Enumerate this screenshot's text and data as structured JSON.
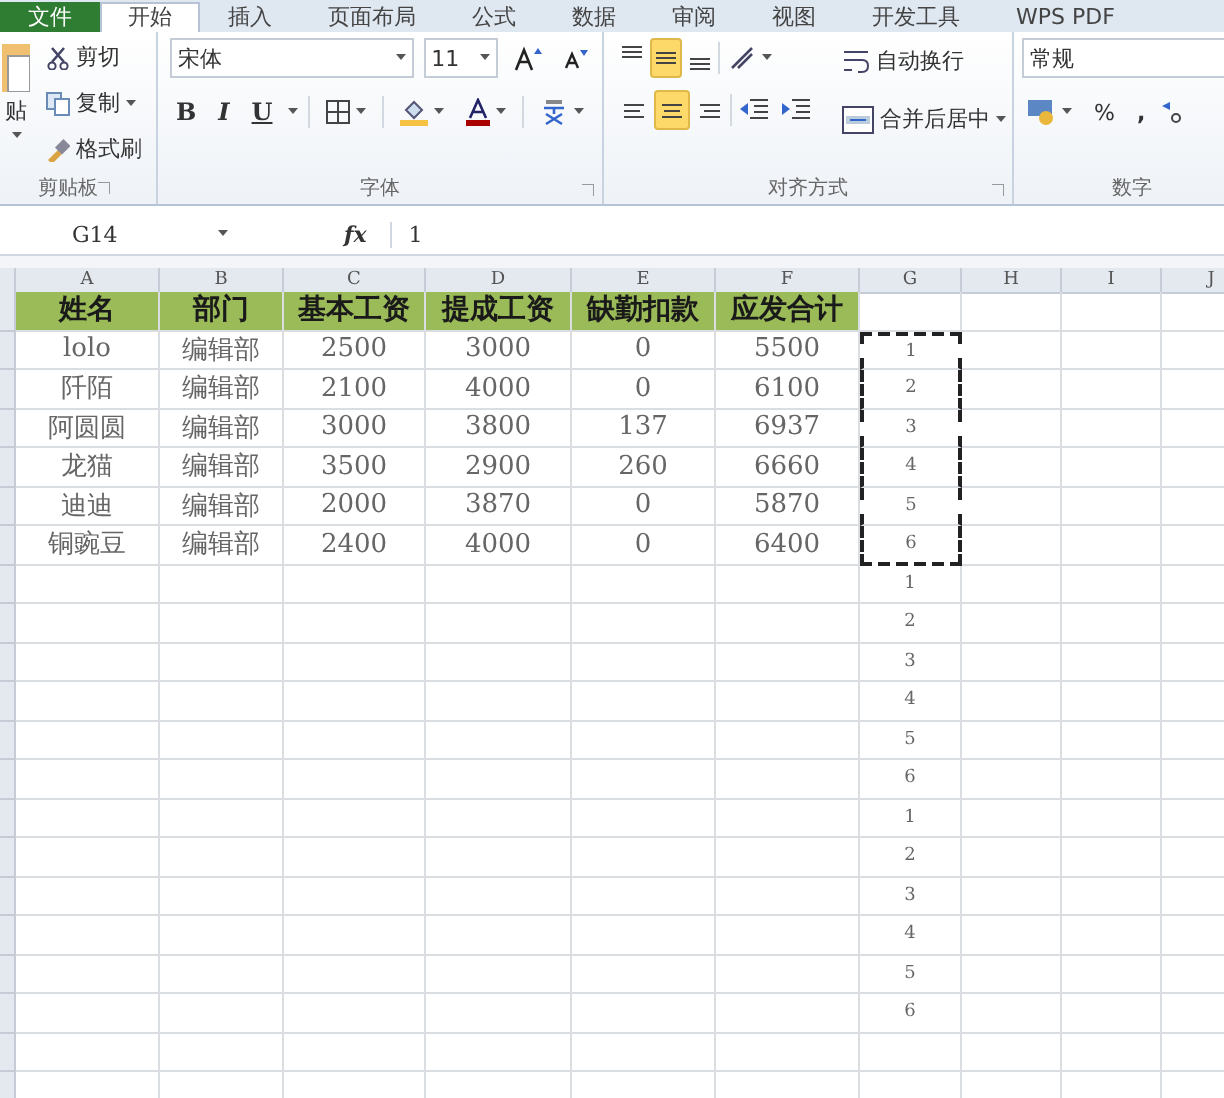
{
  "ribbon_tabs": [
    {
      "label": "文件",
      "kind": "file",
      "selected": false
    },
    {
      "label": "开始",
      "kind": "tab",
      "selected": true
    },
    {
      "label": "插入",
      "kind": "tab",
      "selected": false
    },
    {
      "label": "页面布局",
      "kind": "tab",
      "selected": false
    },
    {
      "label": "公式",
      "kind": "tab",
      "selected": false
    },
    {
      "label": "数据",
      "kind": "tab",
      "selected": false
    },
    {
      "label": "审阅",
      "kind": "tab",
      "selected": false
    },
    {
      "label": "视图",
      "kind": "tab",
      "selected": false
    },
    {
      "label": "开发工具",
      "kind": "tab",
      "selected": false
    },
    {
      "label": "WPS PDF",
      "kind": "tab",
      "selected": false
    }
  ],
  "clipboard": {
    "paste": "贴",
    "cut": "剪切",
    "copy": "复制",
    "format_painter": "格式刷",
    "group_label": "剪贴板"
  },
  "font": {
    "name": "宋体",
    "size": "11",
    "bold": "B",
    "italic": "I",
    "underline": "U",
    "group_label": "字体"
  },
  "alignment": {
    "vertical": [
      {
        "selected": false
      },
      {
        "selected": true
      },
      {
        "selected": false
      }
    ],
    "horizontal": [
      {
        "selected": false
      },
      {
        "selected": true
      },
      {
        "selected": false
      }
    ],
    "wrap": "自动换行",
    "merge": "合并后居中",
    "group_label": "对齐方式"
  },
  "number": {
    "format": "常规",
    "percent": "%",
    "comma": ",",
    "group_label": "数字"
  },
  "formula_bar": {
    "name_box": "G14",
    "fx": "fx",
    "value": "1"
  },
  "sheet": {
    "columns": [
      "A",
      "B",
      "C",
      "D",
      "E",
      "F",
      "G",
      "H",
      "I",
      "J"
    ],
    "header_row": [
      "姓名",
      "部门",
      "基本工资",
      "提成工资",
      "缺勤扣款",
      "应发合计"
    ],
    "rows": [
      {
        "cells": [
          "lolo",
          "编辑部",
          "2500",
          "3000",
          "0",
          "5500"
        ],
        "g": "1",
        "in_copy_range": true
      },
      {
        "cells": [
          "阡陌",
          "编辑部",
          "2100",
          "4000",
          "0",
          "6100"
        ],
        "g": "2",
        "in_copy_range": true
      },
      {
        "cells": [
          "阿圆圆",
          "编辑部",
          "3000",
          "3800",
          "137",
          "6937"
        ],
        "g": "3",
        "in_copy_range": true
      },
      {
        "cells": [
          "龙猫",
          "编辑部",
          "3500",
          "2900",
          "260",
          "6660"
        ],
        "g": "4",
        "in_copy_range": true
      },
      {
        "cells": [
          "迪迪",
          "编辑部",
          "2000",
          "3870",
          "0",
          "5870"
        ],
        "g": "5",
        "in_copy_range": true
      },
      {
        "cells": [
          "铜豌豆",
          "编辑部",
          "2400",
          "4000",
          "0",
          "6400"
        ],
        "g": "6",
        "in_copy_range": true
      },
      {
        "g": "1",
        "in_copy_range": false
      },
      {
        "g": "2",
        "in_copy_range": false
      },
      {
        "g": "3",
        "in_copy_range": false
      },
      {
        "g": "4",
        "in_copy_range": false
      },
      {
        "g": "5",
        "in_copy_range": false
      },
      {
        "g": "6",
        "in_copy_range": false
      },
      {
        "g": "1",
        "in_copy_range": false
      },
      {
        "g": "2",
        "in_copy_range": false
      },
      {
        "g": "3",
        "in_copy_range": false
      },
      {
        "g": "4",
        "in_copy_range": false
      },
      {
        "g": "5",
        "in_copy_range": false
      },
      {
        "g": "6",
        "in_copy_range": false
      }
    ]
  }
}
